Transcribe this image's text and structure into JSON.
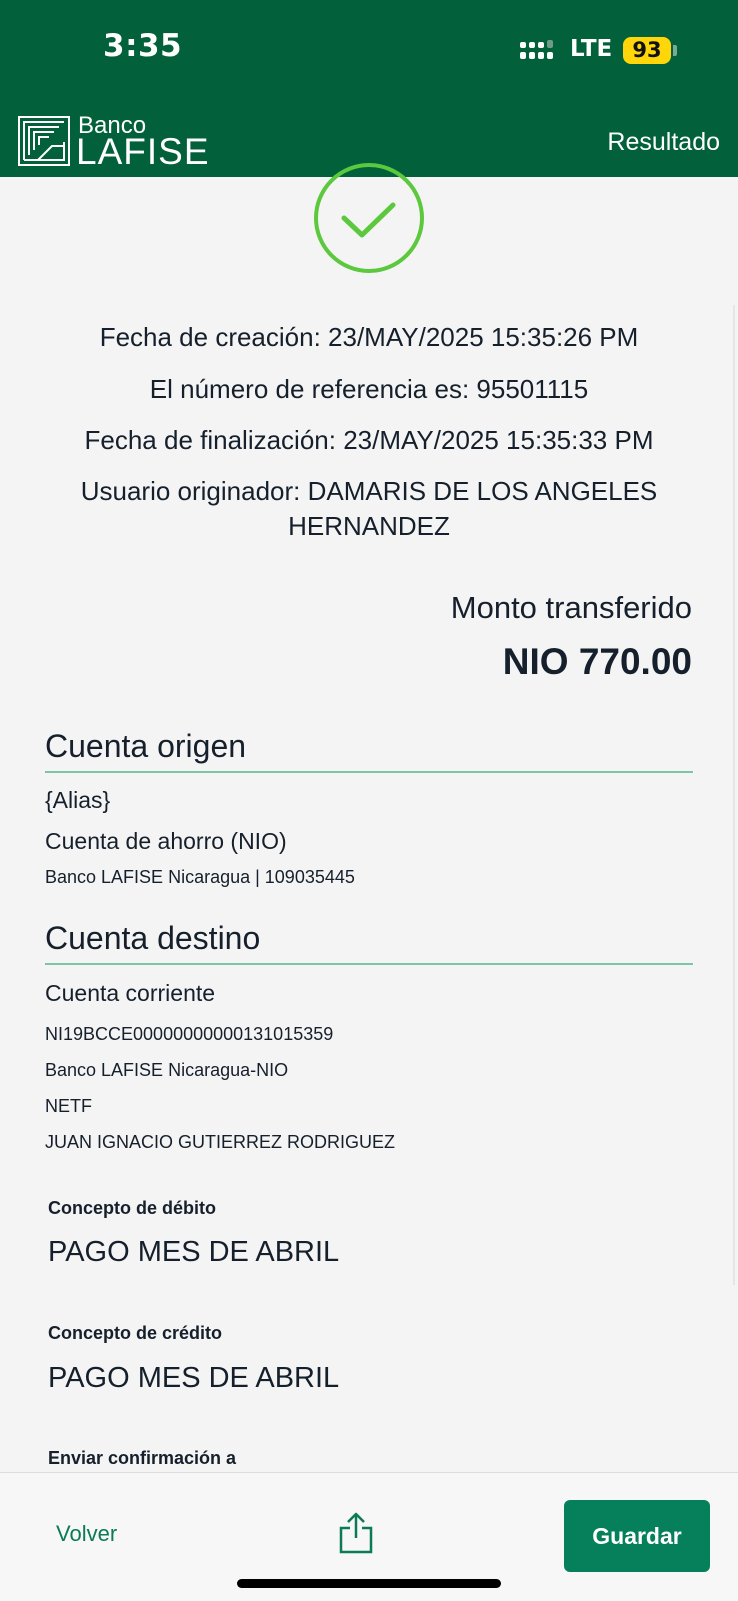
{
  "status_bar": {
    "time": "3:35",
    "network": "LTE",
    "battery": "93",
    "icons": [
      "signal-icon",
      "battery-icon"
    ]
  },
  "header": {
    "logo_top": "Banco",
    "logo_bottom": "LAFISE",
    "title": "Resultado",
    "color": "#02613a"
  },
  "result": {
    "icon": "check-circle-icon",
    "icon_color": "#5cc83d",
    "creation_date": "Fecha de creación: 23/MAY/2025 15:35:26 PM",
    "reference": "El número de referencia es: 95501115",
    "completion_date": "Fecha de finalización: 23/MAY/2025 15:35:33 PM",
    "originator_line1": "Usuario originador: DAMARIS DE LOS ANGELES",
    "originator_line2": "HERNANDEZ"
  },
  "amount": {
    "label": "Monto transferido",
    "value": "NIO 770.00"
  },
  "origin_account": {
    "title": "Cuenta origen",
    "alias": "{Alias}",
    "type": "Cuenta de ahorro (NIO)",
    "bank_and_number": "Banco LAFISE Nicaragua | 109035445"
  },
  "destination_account": {
    "title": "Cuenta destino",
    "type": "Cuenta corriente",
    "iban": "NI19BCCE00000000000131015359",
    "bank": "Banco LAFISE Nicaragua-NIO",
    "network": "NETF",
    "holder": "JUAN IGNACIO GUTIERREZ RODRIGUEZ"
  },
  "concepts": {
    "debit_label": "Concepto de débito",
    "debit_value": "PAGO MES DE ABRIL",
    "credit_label": "Concepto de crédito",
    "credit_value": "PAGO MES DE ABRIL",
    "confirmation_label": "Enviar confirmación a"
  },
  "actions": {
    "back_label": "Volver",
    "share_icon": "share-icon",
    "save_label": "Guardar",
    "accent": "#06805a"
  }
}
